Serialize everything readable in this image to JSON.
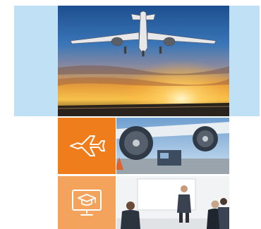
{
  "colors": {
    "side_panel": "#bfe0f5",
    "tile_orange": "#ef7d1b",
    "tile_orange_light": "#f4a35d",
    "icon_stroke": "#ffffff"
  },
  "hero": {
    "image": "airplane-landing-at-sunset"
  },
  "tiles": [
    {
      "icon": "airplane-icon",
      "photo": "jet-engine-on-tarmac"
    },
    {
      "icon": "graduation-monitor-icon",
      "photo": "business-training-meeting"
    }
  ]
}
